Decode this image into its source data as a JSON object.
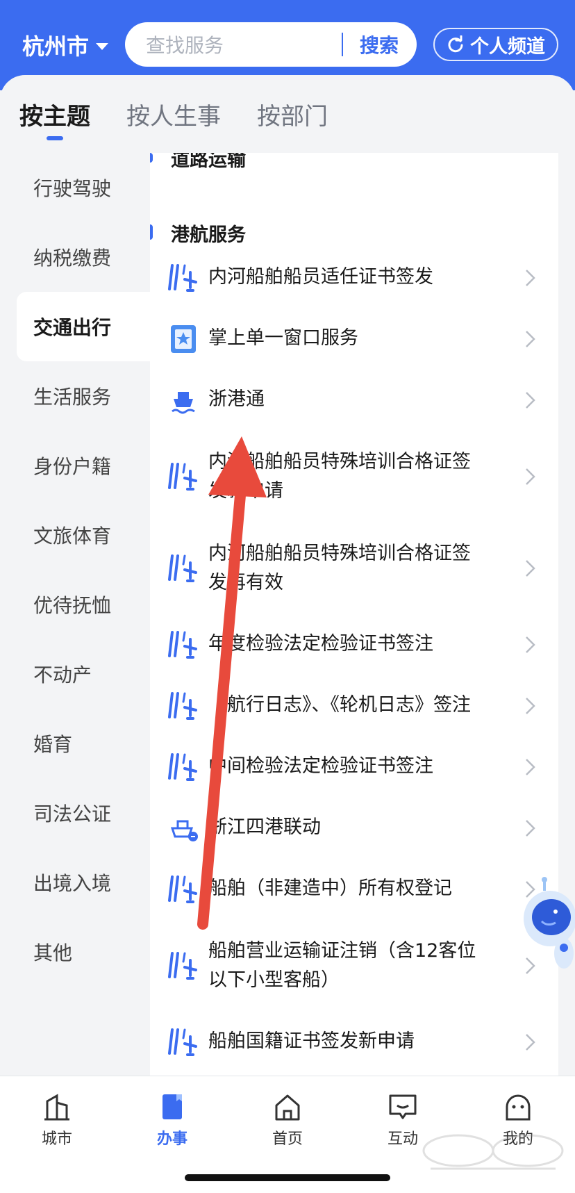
{
  "header": {
    "city": "杭州市",
    "search_placeholder": "查找服务",
    "search_button": "搜索",
    "personal_channel": "个人频道"
  },
  "tabs": [
    {
      "label": "按主题",
      "active": true
    },
    {
      "label": "按人生事",
      "active": false
    },
    {
      "label": "按部门",
      "active": false
    }
  ],
  "sidebar": {
    "items": [
      {
        "label": "行驶驾驶"
      },
      {
        "label": "纳税缴费"
      },
      {
        "label": "交通出行",
        "active": true
      },
      {
        "label": "生活服务"
      },
      {
        "label": "身份户籍"
      },
      {
        "label": "文旅体育"
      },
      {
        "label": "优待抚恤"
      },
      {
        "label": "不动产"
      },
      {
        "label": "婚育"
      },
      {
        "label": "司法公证"
      },
      {
        "label": "出境入境"
      },
      {
        "label": "其他"
      }
    ]
  },
  "panel": {
    "prev_section": "道路运输",
    "section": "港航服务",
    "services": [
      {
        "label": "内河船舶船员适任证书签发",
        "icon": "port-ship-icon"
      },
      {
        "label": "掌上单一窗口服务",
        "icon": "id-card-icon"
      },
      {
        "label": "浙港通",
        "icon": "ship-logo-icon"
      },
      {
        "label": "内河船舶船员特殊培训合格证签发新申请",
        "icon": "port-ship-icon"
      },
      {
        "label": "内河船舶船员特殊培训合格证签发再有效",
        "icon": "port-ship-icon"
      },
      {
        "label": "年度检验法定检验证书签注",
        "icon": "port-ship-icon"
      },
      {
        "label": "《航行日志》、《轮机日志》签注",
        "icon": "port-ship-icon"
      },
      {
        "label": "中间检验法定检验证书签注",
        "icon": "port-ship-icon"
      },
      {
        "label": "浙江四港联动",
        "icon": "ship-link-icon"
      },
      {
        "label": "船舶（非建造中）所有权登记",
        "icon": "port-ship-icon"
      },
      {
        "label": "船舶营业运输证注销（含12客位以下小型客船）",
        "icon": "port-ship-icon"
      },
      {
        "label": "船舶国籍证书签发新申请",
        "icon": "port-ship-icon"
      }
    ]
  },
  "bottom_nav": [
    {
      "label": "城市",
      "icon": "city-icon"
    },
    {
      "label": "办事",
      "icon": "affairs-icon",
      "active": true
    },
    {
      "label": "首页",
      "icon": "home-icon"
    },
    {
      "label": "互动",
      "icon": "chat-icon"
    },
    {
      "label": "我的",
      "icon": "profile-icon"
    }
  ],
  "colors": {
    "primary": "#3b6cf0",
    "arrow": "#e84a3c"
  }
}
